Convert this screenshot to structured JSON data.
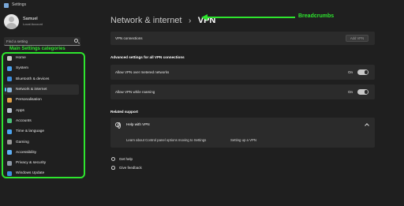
{
  "window": {
    "title": "Settings"
  },
  "profile": {
    "name": "Samuel",
    "account_type": "Local Account"
  },
  "search": {
    "placeholder": "Find a setting"
  },
  "annotations": {
    "categories": "Main Settings categories",
    "breadcrumbs": "Breadcrumbs",
    "color": "#2ee52e"
  },
  "sidebar": {
    "items": [
      {
        "label": "Home",
        "icon": "home-icon",
        "color": "#c9c9c9",
        "active": false
      },
      {
        "label": "System",
        "icon": "monitor-icon",
        "color": "#4aa3f0",
        "active": false
      },
      {
        "label": "Bluetooth & devices",
        "icon": "bluetooth-icon",
        "color": "#3d8fe0",
        "active": false
      },
      {
        "label": "Network & internet",
        "icon": "wifi-icon",
        "color": "#8ab4d9",
        "active": true
      },
      {
        "label": "Personalisation",
        "icon": "brush-icon",
        "color": "#e0a24a",
        "active": false
      },
      {
        "label": "Apps",
        "icon": "apps-icon",
        "color": "#b9c3d0",
        "active": false
      },
      {
        "label": "Accounts",
        "icon": "person-icon",
        "color": "#4cc27a",
        "active": false
      },
      {
        "label": "Time & language",
        "icon": "globe-clock-icon",
        "color": "#4aa3f0",
        "active": false
      },
      {
        "label": "Gaming",
        "icon": "gamepad-icon",
        "color": "#9a9a9a",
        "active": false
      },
      {
        "label": "Accessibility",
        "icon": "accessibility-icon",
        "color": "#5fb0f5",
        "active": false
      },
      {
        "label": "Privacy & security",
        "icon": "shield-icon",
        "color": "#8f9aa8",
        "active": false
      },
      {
        "label": "Windows Update",
        "icon": "update-icon",
        "color": "#3d8fe0",
        "active": false
      }
    ]
  },
  "breadcrumb": {
    "parent": "Network & internet",
    "separator": "›",
    "current": "VPN"
  },
  "vpn_connections": {
    "label": "VPN connections",
    "button": "Add VPN"
  },
  "advanced": {
    "title": "Advanced settings for all VPN connections",
    "metered": {
      "label": "Allow VPN over metered networks",
      "state": "On"
    },
    "roaming": {
      "label": "Allow VPN while roaming",
      "state": "On"
    }
  },
  "related": {
    "title": "Related support",
    "help_title": "Help with VPN",
    "link1": "Learn about Control panel options moving to Settings",
    "link2": "Setting up a VPN"
  },
  "footer": {
    "get_help": "Get help",
    "give_feedback": "Give feedback"
  },
  "colors": {
    "background": "#1f1f1f",
    "card": "#2b2b2b",
    "accent": "#4cc2ff"
  }
}
